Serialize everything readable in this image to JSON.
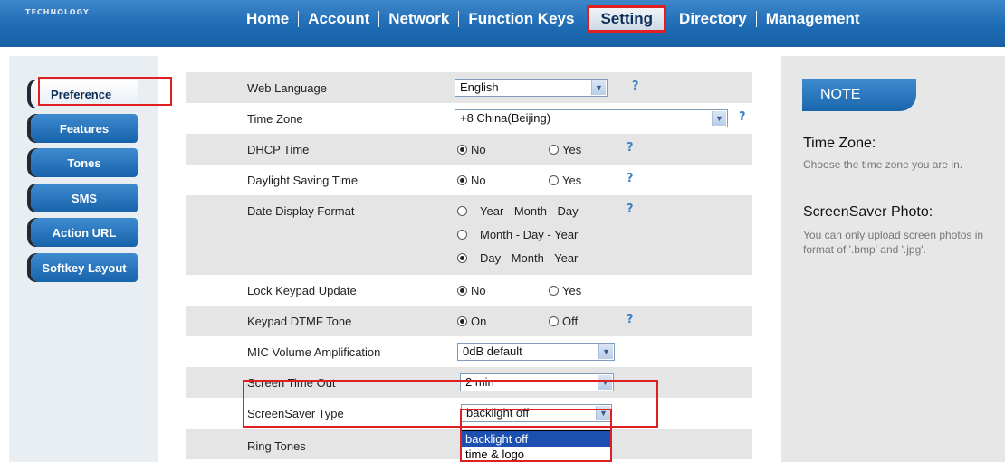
{
  "header": {
    "logo_sub": "TECHNOLOGY",
    "nav": [
      "Home",
      "Account",
      "Network",
      "Function Keys",
      "Setting",
      "Directory",
      "Management"
    ],
    "active_nav": "Setting"
  },
  "sidebar": {
    "items": [
      {
        "label": "Preference"
      },
      {
        "label": "Features"
      },
      {
        "label": "Tones"
      },
      {
        "label": "SMS"
      },
      {
        "label": "Action URL"
      },
      {
        "label": "Softkey Layout"
      }
    ]
  },
  "form": {
    "web_language": {
      "label": "Web Language",
      "value": "English"
    },
    "time_zone": {
      "label": "Time Zone",
      "value": "+8 China(Beijing)"
    },
    "dhcp_time": {
      "label": "DHCP Time",
      "opt1": "No",
      "opt2": "Yes"
    },
    "daylight": {
      "label": "Daylight Saving Time",
      "opt1": "No",
      "opt2": "Yes"
    },
    "date_format": {
      "label": "Date Display Format",
      "opt1": "Year - Month - Day",
      "opt2": "Month - Day - Year",
      "opt3": "Day - Month - Year"
    },
    "lock_keypad": {
      "label": "Lock Keypad Update",
      "opt1": "No",
      "opt2": "Yes"
    },
    "dtmf": {
      "label": "Keypad DTMF Tone",
      "opt1": "On",
      "opt2": "Off"
    },
    "mic": {
      "label": "MIC Volume Amplification",
      "value": "0dB default"
    },
    "screen_timeout": {
      "label": "Screen Time Out",
      "value": "2 min"
    },
    "screensaver_type": {
      "label": "ScreenSaver Type",
      "value": "backlight off",
      "options": [
        "backlight off",
        "time & logo"
      ]
    },
    "ring_tones": {
      "label": "Ring Tones"
    },
    "help_glyph": "?"
  },
  "note": {
    "badge": "NOTE",
    "sections": [
      {
        "title": "Time Zone:",
        "text": "Choose the time zone you are in."
      },
      {
        "title": "ScreenSaver Photo:",
        "text": "You can only upload screen photos in format of '.bmp' and '.jpg'."
      }
    ]
  },
  "colors": {
    "accent": "#1f6cb5",
    "highlight": "#e02020",
    "selected_option": "#1c4fb0"
  }
}
